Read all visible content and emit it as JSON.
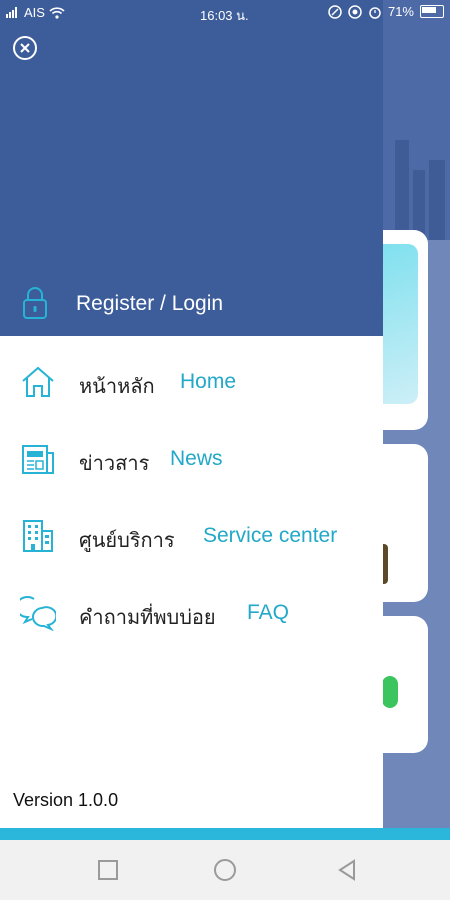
{
  "status_bar": {
    "carrier": "AIS",
    "time": "16:03 น.",
    "battery": "71%"
  },
  "drawer": {
    "login_label": "Register / Login",
    "menu": [
      {
        "th": "หน้าหลัก",
        "en": "Home",
        "icon": "home-icon"
      },
      {
        "th": "ข่าวสาร",
        "en": "News",
        "icon": "newspaper-icon"
      },
      {
        "th": "ศูนย์บริการ",
        "en": "Service center",
        "icon": "building-icon"
      },
      {
        "th": "คำถามที่พบบ่อย",
        "en": "FAQ",
        "icon": "chat-bubbles-icon"
      }
    ],
    "version": "Version 1.0.0"
  },
  "colors": {
    "header": "#3d5d9a",
    "accent": "#22a8c8"
  }
}
